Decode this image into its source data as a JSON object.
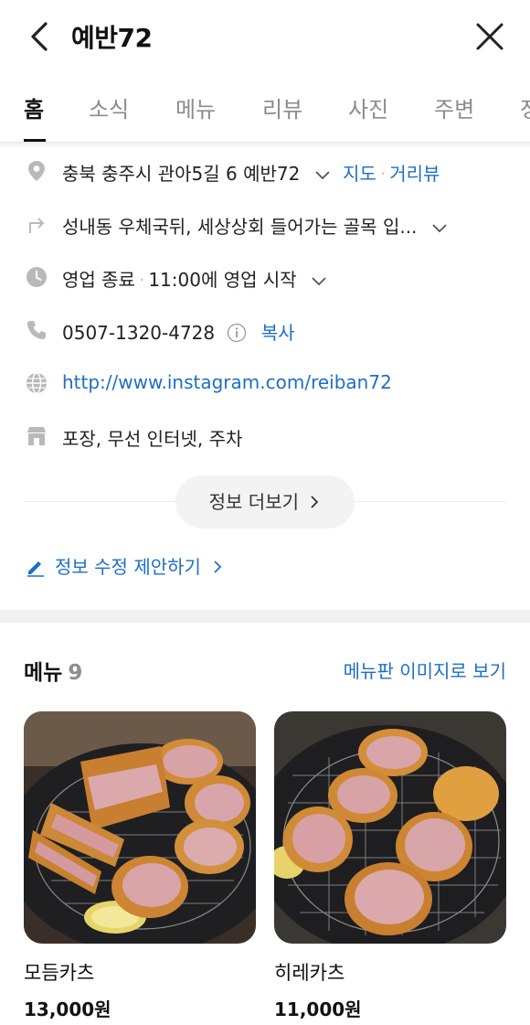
{
  "header": {
    "title": "예반72"
  },
  "tabs": [
    {
      "label": "홈",
      "active": true
    },
    {
      "label": "소식"
    },
    {
      "label": "메뉴"
    },
    {
      "label": "리뷰"
    },
    {
      "label": "사진"
    },
    {
      "label": "주변"
    },
    {
      "label": "정"
    }
  ],
  "info": {
    "address": {
      "text": "충북 충주시 관아5길 6 예반72",
      "map_link": "지도",
      "roadview_link": "거리뷰"
    },
    "directions": "성내동 우체국뒤, 세상상회 들어가는 골목 입...",
    "hours": {
      "status": "영업 종료",
      "next": "11:00에 영업 시작"
    },
    "phone": {
      "number": "0507-1320-4728",
      "copy_label": "복사"
    },
    "website": "http://www.instagram.com/reiban72",
    "amenities": "포장, 무선 인터넷, 주차"
  },
  "more_info_label": "정보 더보기",
  "suggest_edit_label": "정보 수정 제안하기",
  "menu": {
    "title": "메뉴",
    "count": "9",
    "board_link": "메뉴판 이미지로 보기",
    "items": [
      {
        "name": "모듬카츠",
        "price": "13,000원"
      },
      {
        "name": "히레카츠",
        "price": "11,000원"
      }
    ]
  },
  "colors": {
    "link": "#1d6fc6",
    "icon_gray": "#b9b9b9",
    "text": "#222222"
  }
}
